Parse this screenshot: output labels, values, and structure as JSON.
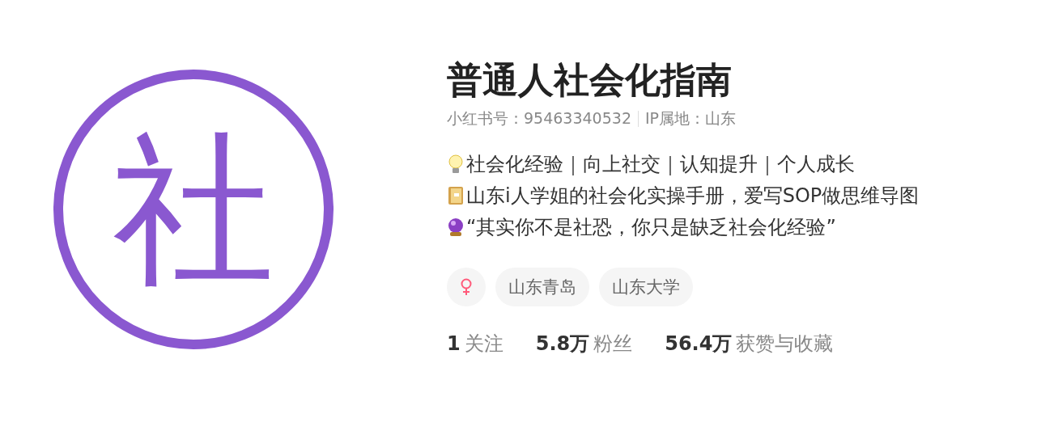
{
  "avatar": {
    "text": "社"
  },
  "profile": {
    "name": "普通人社会化指南",
    "id_label": "小红书号：95463340532",
    "ip_label": "IP属地：山东"
  },
  "bio": [
    {
      "kind": "bulb",
      "text": "社会化经验｜向上社交｜认知提升｜个人成长"
    },
    {
      "kind": "book",
      "text": "山东i人学姐的社会化实操手册，爱写SOP做思维导图"
    },
    {
      "kind": "crystal-ball",
      "text": "“其实你不是社恐，你只是缺乏社会化经验”"
    }
  ],
  "tags": [
    {
      "kind": "gender",
      "color": "#ff5a7a"
    },
    {
      "kind": "text",
      "text": "山东青岛"
    },
    {
      "kind": "text",
      "text": "山东大学"
    }
  ],
  "stats": [
    {
      "count": "1",
      "caption": "关注"
    },
    {
      "count": "5.8万",
      "caption": "粉丝"
    },
    {
      "count": "56.4万",
      "caption": "获赞与收藏"
    }
  ]
}
